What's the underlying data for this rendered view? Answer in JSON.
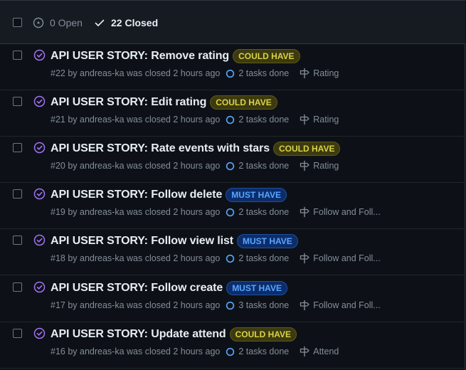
{
  "filters": {
    "open_label": "0 Open",
    "closed_label": "22 Closed"
  },
  "issues": [
    {
      "title": "API USER STORY: Remove rating",
      "label": "COULD HAVE",
      "label_kind": "could",
      "meta": "#22 by andreas-ka was closed 2 hours ago",
      "tasks": "2 tasks done",
      "milestone": "Rating"
    },
    {
      "title": "API USER STORY: Edit rating",
      "label": "COULD HAVE",
      "label_kind": "could",
      "meta": "#21 by andreas-ka was closed 2 hours ago",
      "tasks": "2 tasks done",
      "milestone": "Rating"
    },
    {
      "title": "API USER STORY: Rate events with stars",
      "label": "COULD HAVE",
      "label_kind": "could",
      "meta": "#20 by andreas-ka was closed 2 hours ago",
      "tasks": "2 tasks done",
      "milestone": "Rating"
    },
    {
      "title": "API USER STORY: Follow delete",
      "label": "MUST HAVE",
      "label_kind": "must",
      "meta": "#19 by andreas-ka was closed 2 hours ago",
      "tasks": "2 tasks done",
      "milestone": "Follow and Foll..."
    },
    {
      "title": "API USER STORY: Follow view list",
      "label": "MUST HAVE",
      "label_kind": "must",
      "meta": "#18 by andreas-ka was closed 2 hours ago",
      "tasks": "2 tasks done",
      "milestone": "Follow and Foll..."
    },
    {
      "title": "API USER STORY: Follow create",
      "label": "MUST HAVE",
      "label_kind": "must",
      "meta": "#17 by andreas-ka was closed 2 hours ago",
      "tasks": "3 tasks done",
      "milestone": "Follow and Foll..."
    },
    {
      "title": "API USER STORY: Update attend",
      "label": "COULD HAVE",
      "label_kind": "could",
      "meta": "#16 by andreas-ka was closed 2 hours ago",
      "tasks": "2 tasks done",
      "milestone": "Attend"
    }
  ],
  "colors": {
    "closed_icon": "#a371f7",
    "tasks_icon": "#58a6ff",
    "could_have": "#d7d34a",
    "must_have": "#58a6ff"
  },
  "icons": {
    "open": "issue-open-icon",
    "closed": "check-icon",
    "issue_closed": "issue-closed-icon",
    "tasks": "progress-circle-icon",
    "milestone": "milestone-icon"
  }
}
